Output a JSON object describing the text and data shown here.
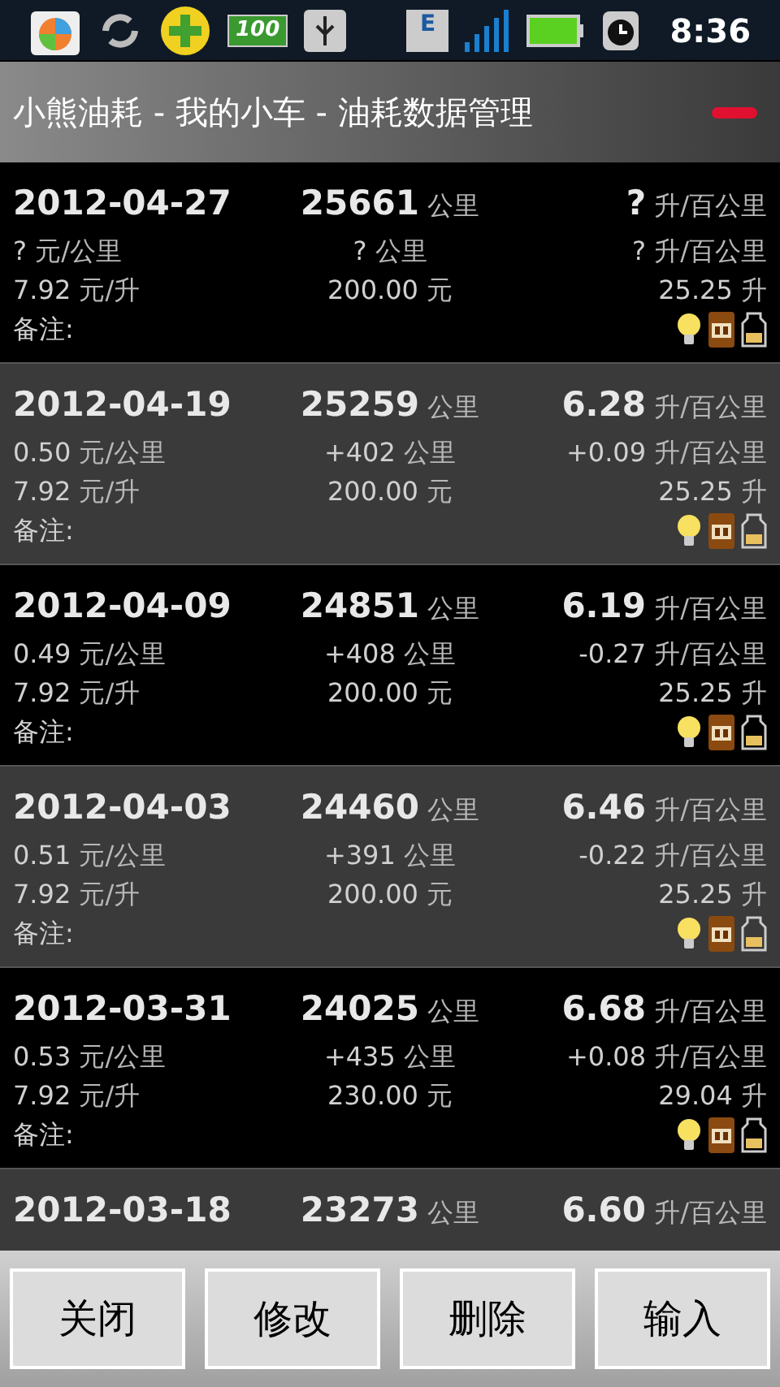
{
  "status_bar": {
    "battery_badge": "100",
    "network_letter": "E",
    "time": "8:36"
  },
  "title": "小熊油耗 - 我的小车 - 油耗数据管理",
  "records": [
    {
      "date": "2012-04-27",
      "odometer": "25661",
      "odometer_unit": "公里",
      "consumption": "?",
      "consumption_unit": "升/百公里",
      "cost_per_km": "?",
      "cost_per_km_unit": "元/公里",
      "distance": "?",
      "distance_unit": "公里",
      "consumption_change": "?",
      "consumption_change_unit": "升/百公里",
      "price": "7.92",
      "price_unit": "元/升",
      "amount": "200.00",
      "amount_unit": "元",
      "volume": "25.25",
      "volume_unit": "升",
      "note_label": "备注:"
    },
    {
      "date": "2012-04-19",
      "odometer": "25259",
      "odometer_unit": "公里",
      "consumption": "6.28",
      "consumption_unit": "升/百公里",
      "cost_per_km": "0.50",
      "cost_per_km_unit": "元/公里",
      "distance": "+402",
      "distance_unit": "公里",
      "consumption_change": "+0.09",
      "consumption_change_unit": "升/百公里",
      "price": "7.92",
      "price_unit": "元/升",
      "amount": "200.00",
      "amount_unit": "元",
      "volume": "25.25",
      "volume_unit": "升",
      "note_label": "备注:"
    },
    {
      "date": "2012-04-09",
      "odometer": "24851",
      "odometer_unit": "公里",
      "consumption": "6.19",
      "consumption_unit": "升/百公里",
      "cost_per_km": "0.49",
      "cost_per_km_unit": "元/公里",
      "distance": "+408",
      "distance_unit": "公里",
      "consumption_change": "-0.27",
      "consumption_change_unit": "升/百公里",
      "price": "7.92",
      "price_unit": "元/升",
      "amount": "200.00",
      "amount_unit": "元",
      "volume": "25.25",
      "volume_unit": "升",
      "note_label": "备注:"
    },
    {
      "date": "2012-04-03",
      "odometer": "24460",
      "odometer_unit": "公里",
      "consumption": "6.46",
      "consumption_unit": "升/百公里",
      "cost_per_km": "0.51",
      "cost_per_km_unit": "元/公里",
      "distance": "+391",
      "distance_unit": "公里",
      "consumption_change": "-0.22",
      "consumption_change_unit": "升/百公里",
      "price": "7.92",
      "price_unit": "元/升",
      "amount": "200.00",
      "amount_unit": "元",
      "volume": "25.25",
      "volume_unit": "升",
      "note_label": "备注:"
    },
    {
      "date": "2012-03-31",
      "odometer": "24025",
      "odometer_unit": "公里",
      "consumption": "6.68",
      "consumption_unit": "升/百公里",
      "cost_per_km": "0.53",
      "cost_per_km_unit": "元/公里",
      "distance": "+435",
      "distance_unit": "公里",
      "consumption_change": "+0.08",
      "consumption_change_unit": "升/百公里",
      "price": "7.92",
      "price_unit": "元/升",
      "amount": "230.00",
      "amount_unit": "元",
      "volume": "29.04",
      "volume_unit": "升",
      "note_label": "备注:"
    },
    {
      "date": "2012-03-18",
      "odometer": "23273",
      "odometer_unit": "公里",
      "consumption": "6.60",
      "consumption_unit": "升/百公里"
    }
  ],
  "buttons": [
    "关闭",
    "修改",
    "删除",
    "输入"
  ]
}
